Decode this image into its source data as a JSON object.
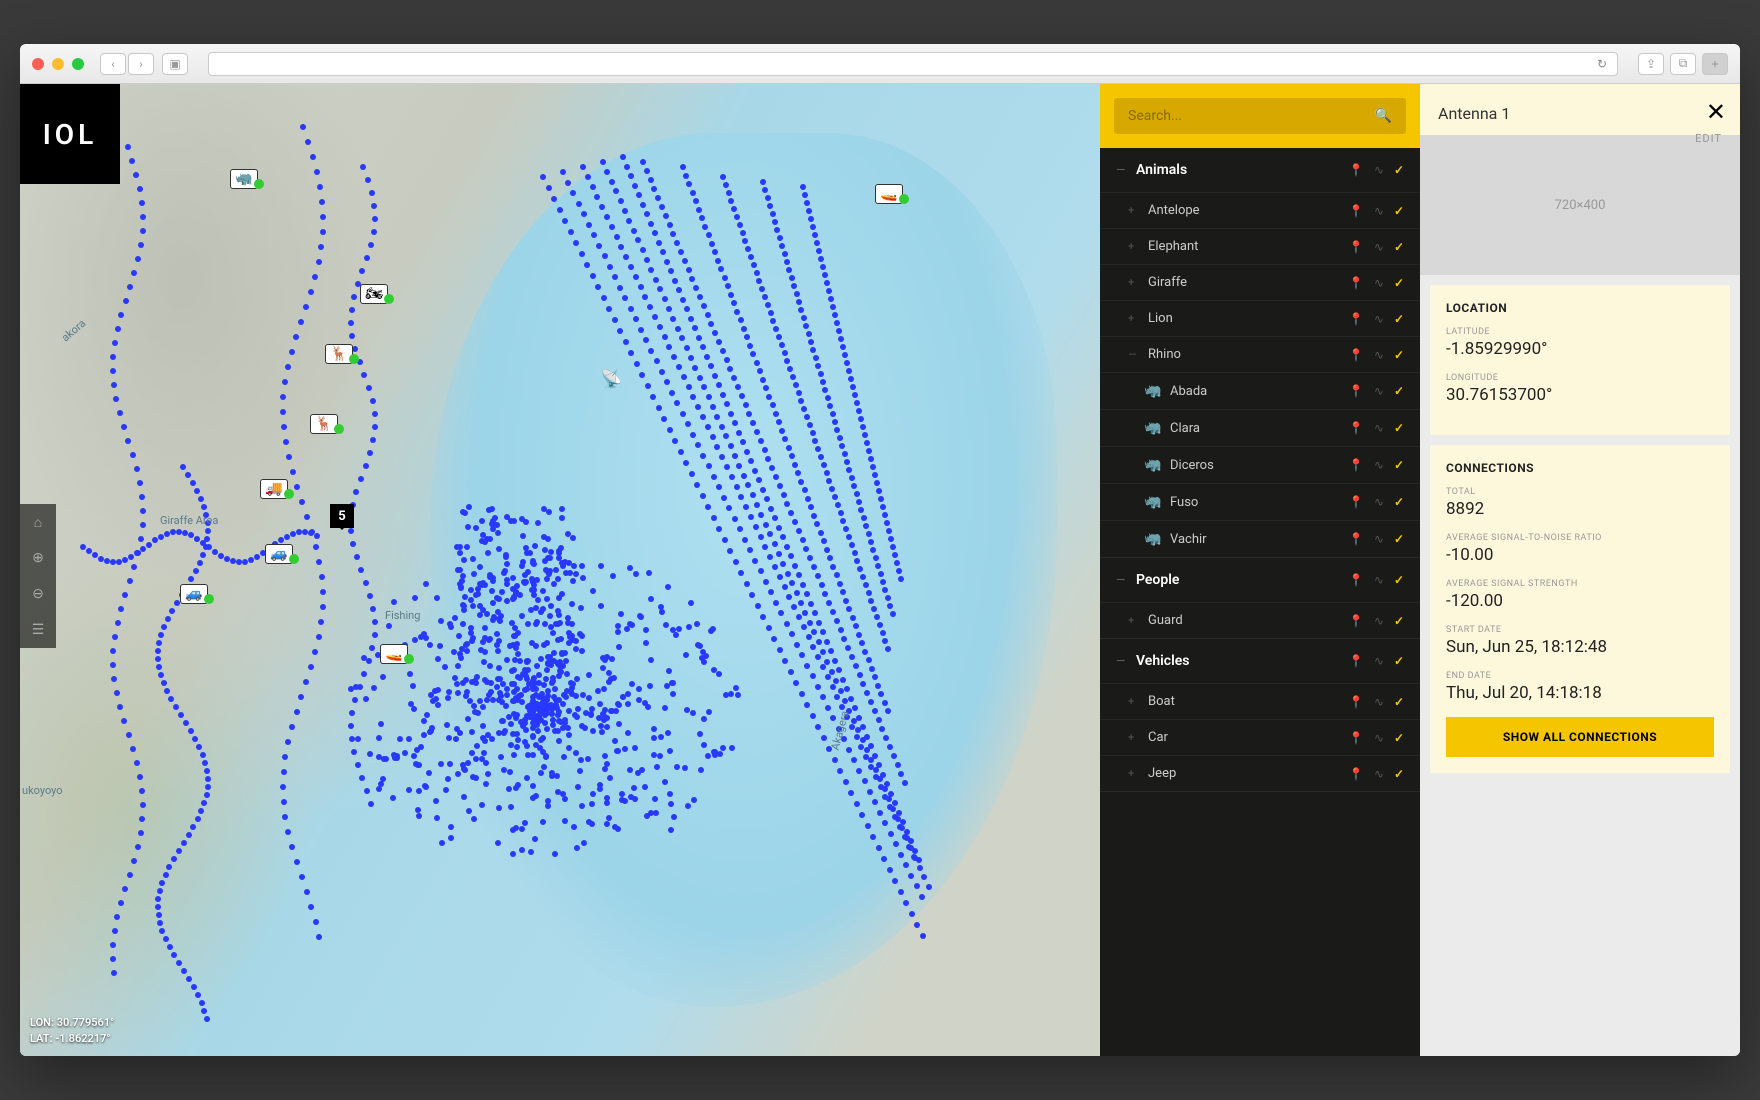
{
  "logo": "IOL",
  "search": {
    "placeholder": "Search..."
  },
  "coords": {
    "lon": "LON: 30.779561°",
    "lat": "LAT: -1.862217°"
  },
  "mapLabels": {
    "giraffe": "Giraffe Area",
    "fishing": "Fishing",
    "akora": "akora",
    "ukoyoyo": "ukoyoyo",
    "akagera": "Akagera"
  },
  "countMarker": "5",
  "categories": [
    {
      "label": "Animals",
      "expanded": true,
      "items": [
        {
          "label": "Antelope"
        },
        {
          "label": "Elephant"
        },
        {
          "label": "Giraffe"
        },
        {
          "label": "Lion"
        },
        {
          "label": "Rhino",
          "expanded": true,
          "children": [
            {
              "label": "Abada"
            },
            {
              "label": "Clara"
            },
            {
              "label": "Diceros"
            },
            {
              "label": "Fuso"
            },
            {
              "label": "Vachir"
            }
          ]
        }
      ]
    },
    {
      "label": "People",
      "expanded": true,
      "items": [
        {
          "label": "Guard"
        }
      ]
    },
    {
      "label": "Vehicles",
      "expanded": true,
      "items": [
        {
          "label": "Boat"
        },
        {
          "label": "Car"
        },
        {
          "label": "Jeep"
        }
      ]
    }
  ],
  "detail": {
    "title": "Antenna 1",
    "edit": "EDIT",
    "placeholder": "720×400",
    "location": {
      "title": "LOCATION",
      "lat_l": "LATITUDE",
      "lat_v": "-1.85929990°",
      "lon_l": "LONGITUDE",
      "lon_v": "30.76153700°"
    },
    "connections": {
      "title": "CONNECTIONS",
      "total_l": "TOTAL",
      "total_v": "8892",
      "snr_l": "AVERAGE SIGNAL-TO-NOISE RATIO",
      "snr_v": "-10.00",
      "ss_l": "AVERAGE SIGNAL STRENGTH",
      "ss_v": "-120.00",
      "start_l": "START DATE",
      "start_v": "Sun, Jun 25, 18:12:48",
      "end_l": "END DATE",
      "end_v": "Thu, Jul 20, 14:18:18",
      "button": "SHOW ALL CONNECTIONS"
    }
  }
}
